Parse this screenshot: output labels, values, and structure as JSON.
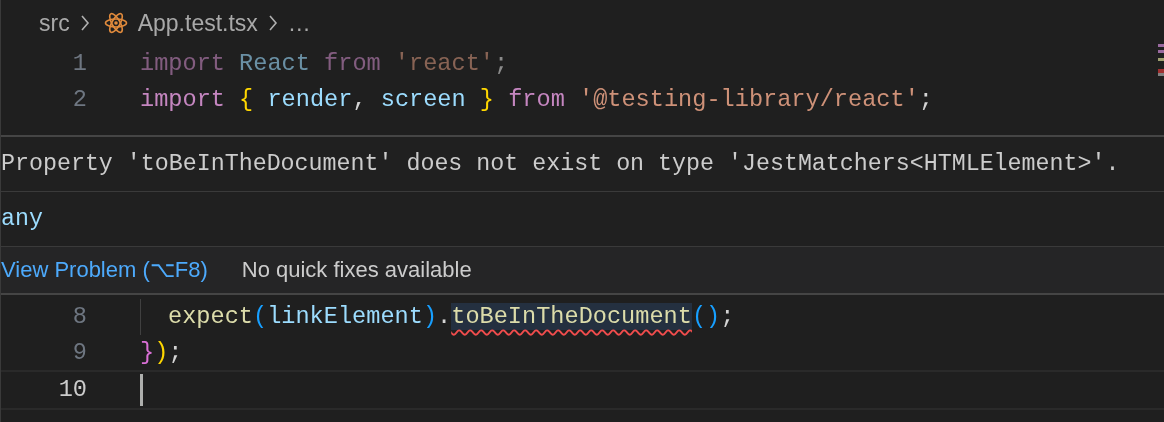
{
  "breadcrumb": [
    {
      "label": "src",
      "kind": "folder"
    },
    {
      "label": "App.test.tsx",
      "kind": "react-file"
    },
    {
      "label": "…",
      "kind": "symbol"
    }
  ],
  "code_top": [
    {
      "number": "1",
      "faded": true,
      "current": false,
      "indent": false,
      "tokens": [
        {
          "text": "import",
          "kind": "keyword"
        },
        {
          "text": " React",
          "kind": "variable"
        },
        {
          "text": " from",
          "kind": "keyword"
        },
        {
          "text": " 'react'",
          "kind": "string"
        },
        {
          "text": ";",
          "kind": "punct"
        }
      ]
    },
    {
      "number": "2",
      "faded": false,
      "current": false,
      "indent": false,
      "tokens": [
        {
          "text": "import",
          "kind": "keyword"
        },
        {
          "text": " {",
          "kind": "bracket1"
        },
        {
          "text": " render",
          "kind": "variable"
        },
        {
          "text": ",",
          "kind": "punct"
        },
        {
          "text": " screen",
          "kind": "variable"
        },
        {
          "text": " }",
          "kind": "bracket1"
        },
        {
          "text": " from",
          "kind": "keyword"
        },
        {
          "text": " '@testing-library/react'",
          "kind": "string"
        },
        {
          "text": ";",
          "kind": "punct"
        }
      ]
    }
  ],
  "hover": {
    "message": "Property 'toBeInTheDocument' does not exist on type 'JestMatchers<HTMLElement>'.",
    "type": "any",
    "actions": [
      {
        "label": "View Problem (⌥F8)",
        "kind": "link"
      },
      {
        "label": "No quick fixes available",
        "kind": "text"
      }
    ]
  },
  "code_bottom": [
    {
      "number": "8",
      "faded": false,
      "current": false,
      "indent": true,
      "tokens": [
        {
          "text": "expect",
          "kind": "function"
        },
        {
          "text": "(",
          "kind": "bracket3"
        },
        {
          "text": "linkElement",
          "kind": "variable"
        },
        {
          "text": ")",
          "kind": "bracket3"
        },
        {
          "text": ".",
          "kind": "punct"
        },
        {
          "text": "toBeInTheDocument",
          "kind": "function",
          "error": true
        },
        {
          "text": "(",
          "kind": "bracket3"
        },
        {
          "text": ")",
          "kind": "bracket3"
        },
        {
          "text": ";",
          "kind": "punct"
        }
      ]
    },
    {
      "number": "9",
      "faded": false,
      "current": false,
      "indent": false,
      "tokens": [
        {
          "text": "}",
          "kind": "bracket2"
        },
        {
          "text": ")",
          "kind": "bracket1"
        },
        {
          "text": ";",
          "kind": "punct"
        }
      ]
    },
    {
      "number": "10",
      "faded": false,
      "current": true,
      "indent": false
    }
  ]
}
